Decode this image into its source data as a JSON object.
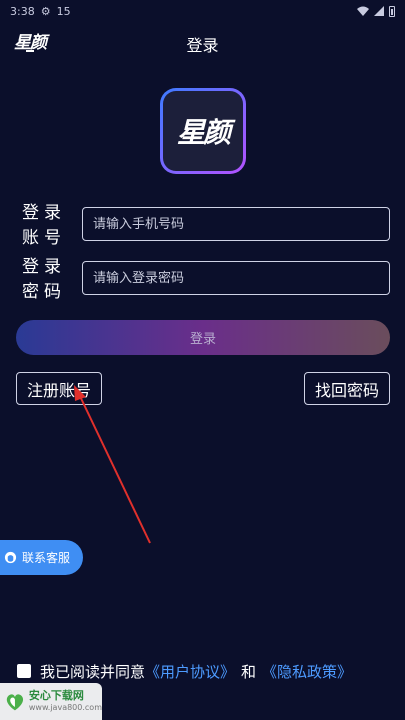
{
  "status_bar": {
    "time": "3:38",
    "app_name": "15"
  },
  "header": {
    "logo_text": "星颜",
    "title": "登录"
  },
  "app_logo": {
    "text": "星颜"
  },
  "account": {
    "label": "登录账号",
    "placeholder": "请输入手机号码",
    "value": ""
  },
  "password": {
    "label": "登录密码",
    "placeholder": "请输入登录密码",
    "value": ""
  },
  "buttons": {
    "login": "登录",
    "register": "注册账号",
    "recover": "找回密码"
  },
  "support": {
    "label": "联系客服"
  },
  "agreement": {
    "prefix": "我已阅读并同意",
    "user_agreement": "《用户协议》",
    "conjunction": "和",
    "privacy_policy": "《隐私政策》",
    "checked": false
  },
  "watermark": {
    "name": "安心下载网",
    "url": "www.java800.com"
  },
  "colors": {
    "background": "#0b0f2b",
    "link": "#4d9bff",
    "support": "#3f8ef3",
    "arrow": "#e0302c"
  }
}
